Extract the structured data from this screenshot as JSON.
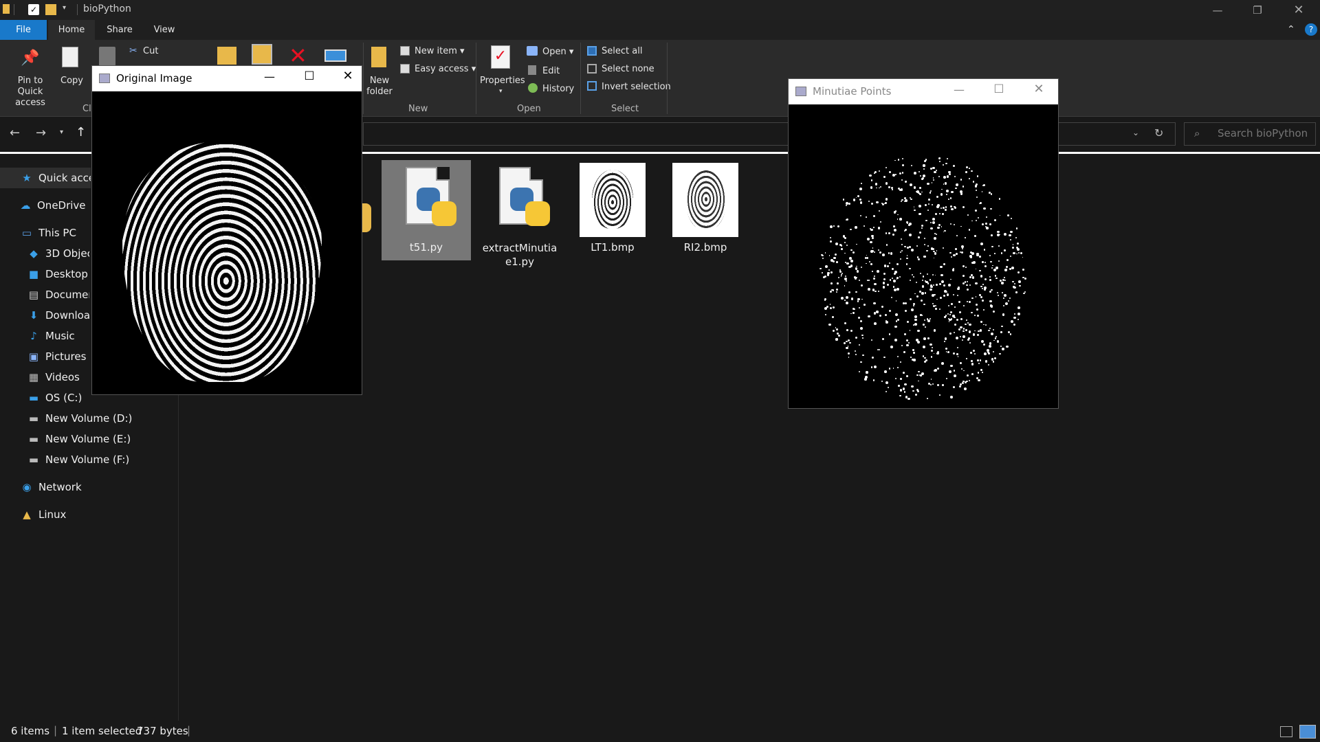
{
  "window": {
    "title": "bioPython"
  },
  "tabs": [
    {
      "label": "File"
    },
    {
      "label": "Home"
    },
    {
      "label": "Share"
    },
    {
      "label": "View"
    }
  ],
  "ribbon": {
    "pin_label": "Pin to Quick access",
    "copy_label": "Copy",
    "cut_label": "Cut",
    "clipboard_group": "Cl",
    "new_folder_label": "New folder",
    "new_item_label": "New item",
    "easy_access_label": "Easy access",
    "new_group": "New",
    "properties_label": "Properties",
    "open_label": "Open",
    "edit_label": "Edit",
    "history_label": "History",
    "open_group": "Open",
    "select_all_label": "Select all",
    "select_none_label": "Select none",
    "invert_selection_label": "Invert selection",
    "select_group": "Select"
  },
  "search": {
    "placeholder": "Search bioPython"
  },
  "nav": {
    "quick_access": "Quick access",
    "onedrive": "OneDrive - ",
    "this_pc": "This PC",
    "objects_3d": "3D Objects",
    "desktop": "Desktop",
    "documents": "Documents",
    "downloads": "Downloads",
    "music": "Music",
    "pictures": "Pictures",
    "videos": "Videos",
    "os_c": "OS (C:)",
    "vol_d": "New Volume (D:)",
    "vol_e": "New Volume (E:)",
    "vol_f": "New Volume (F:)",
    "network": "Network",
    "linux": "Linux"
  },
  "files": [
    {
      "name": "t51.py"
    },
    {
      "name": "extractMinutiae1.py"
    },
    {
      "name": "LT1.bmp"
    },
    {
      "name": "RI2.bmp"
    }
  ],
  "status": {
    "items": "6 items",
    "selected": "1 item selected",
    "size": "737 bytes"
  },
  "original_window": {
    "title": "Original Image"
  },
  "minutiae_window": {
    "title": "Minutiae Points"
  },
  "colors": {
    "accent": "#1979ca",
    "background": "#191919",
    "ribbon": "#2b2b2b"
  }
}
